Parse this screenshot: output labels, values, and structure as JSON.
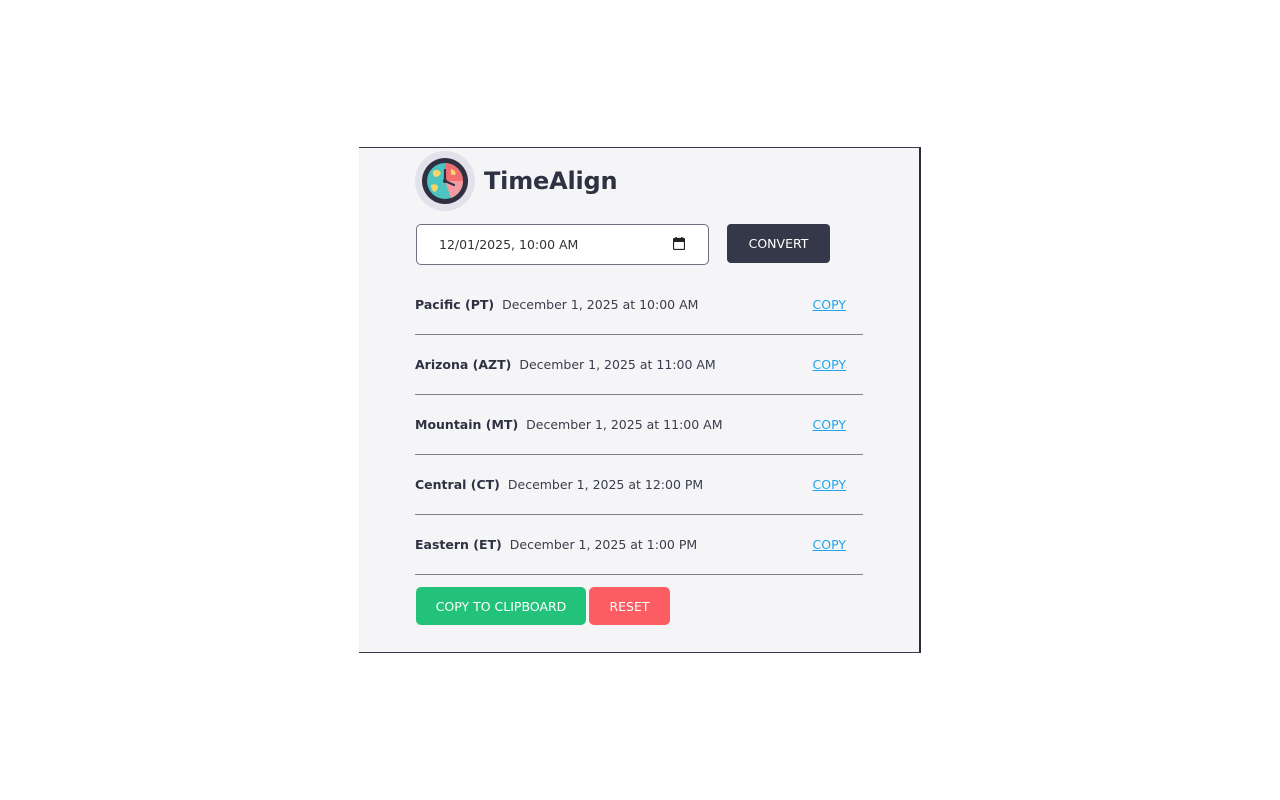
{
  "app": {
    "title": "TimeAlign"
  },
  "input": {
    "value": "12/01/2025, 10:00 AM"
  },
  "buttons": {
    "convert": "CONVERT",
    "copy_clipboard": "COPY TO CLIPBOARD",
    "reset": "RESET"
  },
  "results": [
    {
      "zone": "Pacific (PT)",
      "time": "December 1, 2025 at 10:00 AM",
      "copy": "COPY"
    },
    {
      "zone": "Arizona (AZT)",
      "time": "December 1, 2025 at 11:00 AM",
      "copy": "COPY"
    },
    {
      "zone": "Mountain (MT)",
      "time": "December 1, 2025 at 11:00 AM",
      "copy": "COPY"
    },
    {
      "zone": "Central (CT)",
      "time": "December 1, 2025 at 12:00 PM",
      "copy": "COPY"
    },
    {
      "zone": "Eastern (ET)",
      "time": "December 1, 2025 at 1:00 PM",
      "copy": "COPY"
    }
  ],
  "icons": {
    "logo": "clock-globe-icon",
    "calendar": "calendar-icon"
  },
  "colors": {
    "primary_dark": "#353849",
    "link": "#22a4ea",
    "success": "#23c27a",
    "danger": "#fc5d62"
  }
}
